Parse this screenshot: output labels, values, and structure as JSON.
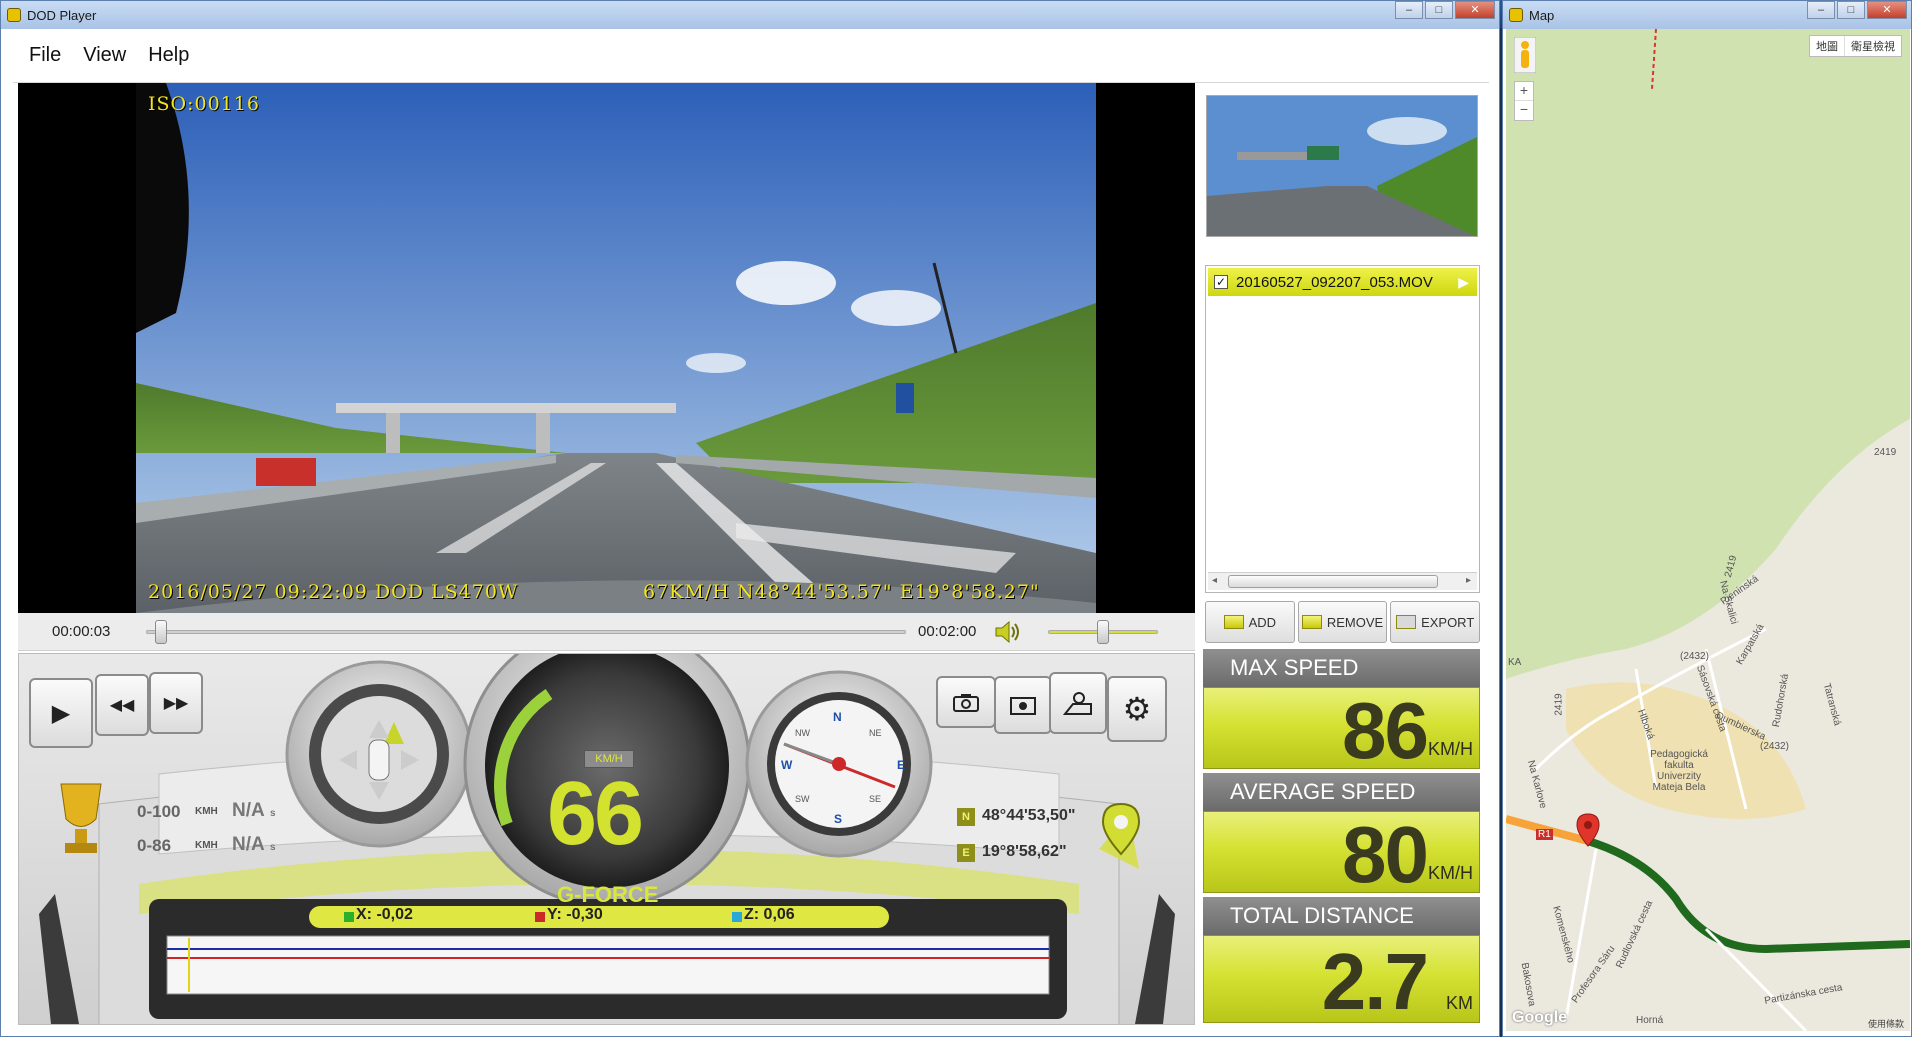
{
  "main_window": {
    "title": "DOD Player"
  },
  "menu": {
    "file": "File",
    "view": "View",
    "help": "Help"
  },
  "video": {
    "iso_overlay": "ISO:00116",
    "datetime_overlay": "2016/05/27  09:22:09 DOD LS470W",
    "gps_overlay": "67KM/H N48°44'53.57\" E19°8'58.27\""
  },
  "timeline": {
    "current_time": "00:00:03",
    "total_time": "00:02:00",
    "position_fraction": 0.02,
    "volume_fraction": 0.5
  },
  "dashboard": {
    "accel_0_100_label": "0-100",
    "accel_0_86_label": "0-86",
    "accel_unit": "KMH",
    "accel_0_100_value": "N/A",
    "accel_0_86_value": "N/A",
    "accel_value_suffix": "s",
    "speed_unit": "KM/H",
    "speed_value": "66",
    "gforce_label": "G-FORCE",
    "gps_n_badge": "N",
    "gps_e_badge": "E",
    "latitude": "48°44'53,50\"",
    "longitude": "19°8'58,62\"",
    "gforce_x": "X: -0,02",
    "gforce_y": "Y: -0,30",
    "gforce_z": "Z: 0,06",
    "compass": {
      "n": "N",
      "ne": "NE",
      "e": "E",
      "se": "SE",
      "s": "S",
      "sw": "SW",
      "w": "W",
      "nw": "NW"
    },
    "colors": {
      "x": "#2bb02b",
      "y": "#cc2a2a",
      "z": "#2aa8d8"
    }
  },
  "files": {
    "items": [
      {
        "name": "20160527_092207_053.MOV",
        "checked": true
      }
    ]
  },
  "actions": {
    "add": "ADD",
    "remove": "REMOVE",
    "export": "EXPORT"
  },
  "stats": {
    "max_speed_label": "MAX SPEED",
    "max_speed_value": "86",
    "max_speed_unit": "KM/H",
    "avg_speed_label": "AVERAGE SPEED",
    "avg_speed_value": "80",
    "avg_speed_unit": "KM/H",
    "distance_label": "TOTAL DISTANCE",
    "distance_value": "2.7",
    "distance_unit": "KM"
  },
  "map_window": {
    "title": "Map",
    "map_type_map": "地圖",
    "map_type_satellite": "衛星檢視",
    "zoom_in": "+",
    "zoom_out": "−",
    "labels": [
      "2419",
      "2419",
      "Na Skalici",
      "Pieninská",
      "(2432)",
      "Sásovská cesta",
      "Karpatská",
      "Hlboká",
      "Dumbierska",
      "Rudohorská",
      "Tatranská",
      "2419",
      "Na Karlove",
      "Pedagogická fakulta Univerzity Mateja Bela",
      "(2432)",
      "R1",
      "Komenského",
      "Profesora Sáru",
      "Rudlovská cesta",
      "Bakosova",
      "Partizánska cesta",
      "Horná",
      "KA"
    ],
    "google": "Google",
    "terms": "使用條款"
  },
  "icons": {
    "play": "▶",
    "rewind": "◀◀",
    "forward": "▶▶",
    "settings": "⚙"
  }
}
